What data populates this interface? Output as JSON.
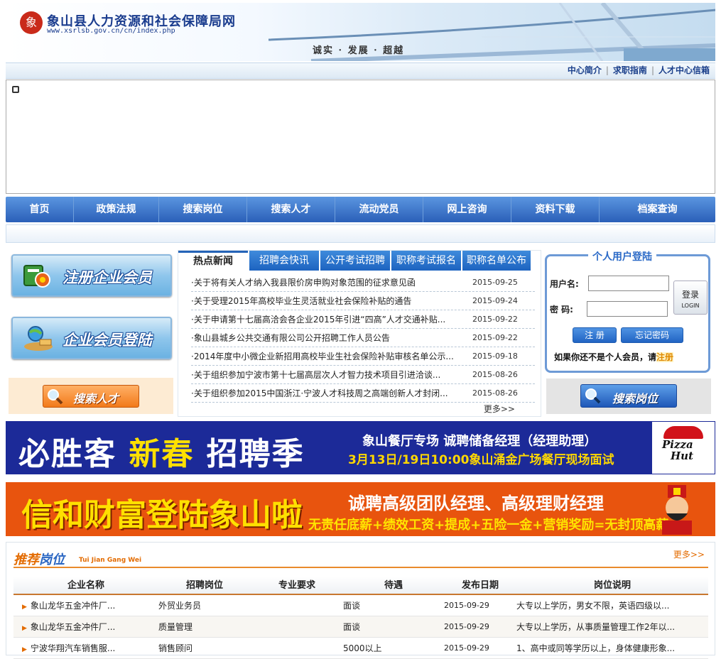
{
  "header": {
    "seal_text": "象",
    "site_name": "象山县人力资源和社会保障局网",
    "site_url": "www.xsrlsb.gov.cn/cn/index.php",
    "slogan": "诚实 · 发展 · 超越"
  },
  "toplinks": [
    "中心简介",
    "求职指南",
    "人才中心信箱"
  ],
  "nav": [
    "首页",
    "政策法规",
    "搜索岗位",
    "搜索人才",
    "流动党员",
    "网上咨询",
    "资料下载",
    "档案查询"
  ],
  "left_buttons": {
    "register": "注册企业会员",
    "member_login": "企业会员登陆",
    "search_talent": "搜索人才"
  },
  "news": {
    "tabs": [
      "热点新闻",
      "招聘会快讯",
      "公开考试招聘",
      "职称考试报名",
      "职称名单公布"
    ],
    "items": [
      {
        "title": "·关于将有关人才纳入我县限价房申购对象范围的征求意见函",
        "date": "2015-09-25"
      },
      {
        "title": "·关于受理2015年高校毕业生灵活就业社会保险补贴的通告",
        "date": "2015-09-24"
      },
      {
        "title": "·关于申请第十七届高洽会各企业2015年引进“四高”人才交通补贴...",
        "date": "2015-09-22"
      },
      {
        "title": "·象山县城乡公共交通有限公司公开招聘工作人员公告",
        "date": "2015-09-22"
      },
      {
        "title": "·2014年度中小微企业新招用高校毕业生社会保险补贴审核名单公示...",
        "date": "2015-09-18"
      },
      {
        "title": "·关于组织参加宁波市第十七届高层次人才智力技术项目引进洽谈...",
        "date": "2015-08-26"
      },
      {
        "title": "·关于组织参加2015中国浙江·宁波人才科技周之高端创新人才封闭...",
        "date": "2015-08-26"
      }
    ],
    "more": "更多>>"
  },
  "login": {
    "title": "个人用户登陆",
    "username_label": "用户名:",
    "password_label": "密 码:",
    "login_button": "登录",
    "login_button_en": "LOGIN",
    "register_button": "注 册",
    "forgot_button": "忘记密码",
    "hint_prefix": "如果你还不是个人会员，请",
    "hint_link": "注册",
    "search_jobs": "搜索岗位"
  },
  "banner1": {
    "part1": "必胜客",
    "part2": "新春",
    "part3": "招聘季",
    "line1": "象山餐厅专场   诚聘储备经理（经理助理）",
    "line2": "3月13日/19日10:00象山涌金广场餐厅现场面试",
    "logo_text_1": "Pizza",
    "logo_text_2": "Hut"
  },
  "banner2": {
    "headline": "信和财富登陆象山啦",
    "line1": "诚聘高级团队经理、高级理财经理",
    "line2": "无责任底薪+绩效工资+提成+五险一金+营销奖励=无封顶高薪"
  },
  "recommend": {
    "title_a": "推荐",
    "title_b": "岗位",
    "subtitle": "Tui Jian Gang Wei",
    "more": "更多>>",
    "headers": [
      "企业名称",
      "招聘岗位",
      "专业要求",
      "待遇",
      "发布日期",
      "岗位说明"
    ],
    "rows": [
      {
        "company": "象山龙华五金冲件厂...",
        "position": "外贸业务员",
        "major": "",
        "pay": "面谈",
        "date": "2015-09-29",
        "desc": "大专以上学历，男女不限，英语四级以..."
      },
      {
        "company": "象山龙华五金冲件厂...",
        "position": "质量管理",
        "major": "",
        "pay": "面谈",
        "date": "2015-09-29",
        "desc": "大专以上学历，从事质量管理工作2年以..."
      },
      {
        "company": "宁波华翔汽车销售服...",
        "position": "销售顾问",
        "major": "",
        "pay": "5000以上",
        "date": "2015-09-29",
        "desc": "1、高中或同等学历以上，身体健康形象..."
      }
    ]
  },
  "colors": {
    "nav_blue": "#2a5fb8",
    "accent_orange": "#e36b00",
    "banner1_bg": "#1c2a98",
    "banner2_bg": "#e8540e"
  }
}
